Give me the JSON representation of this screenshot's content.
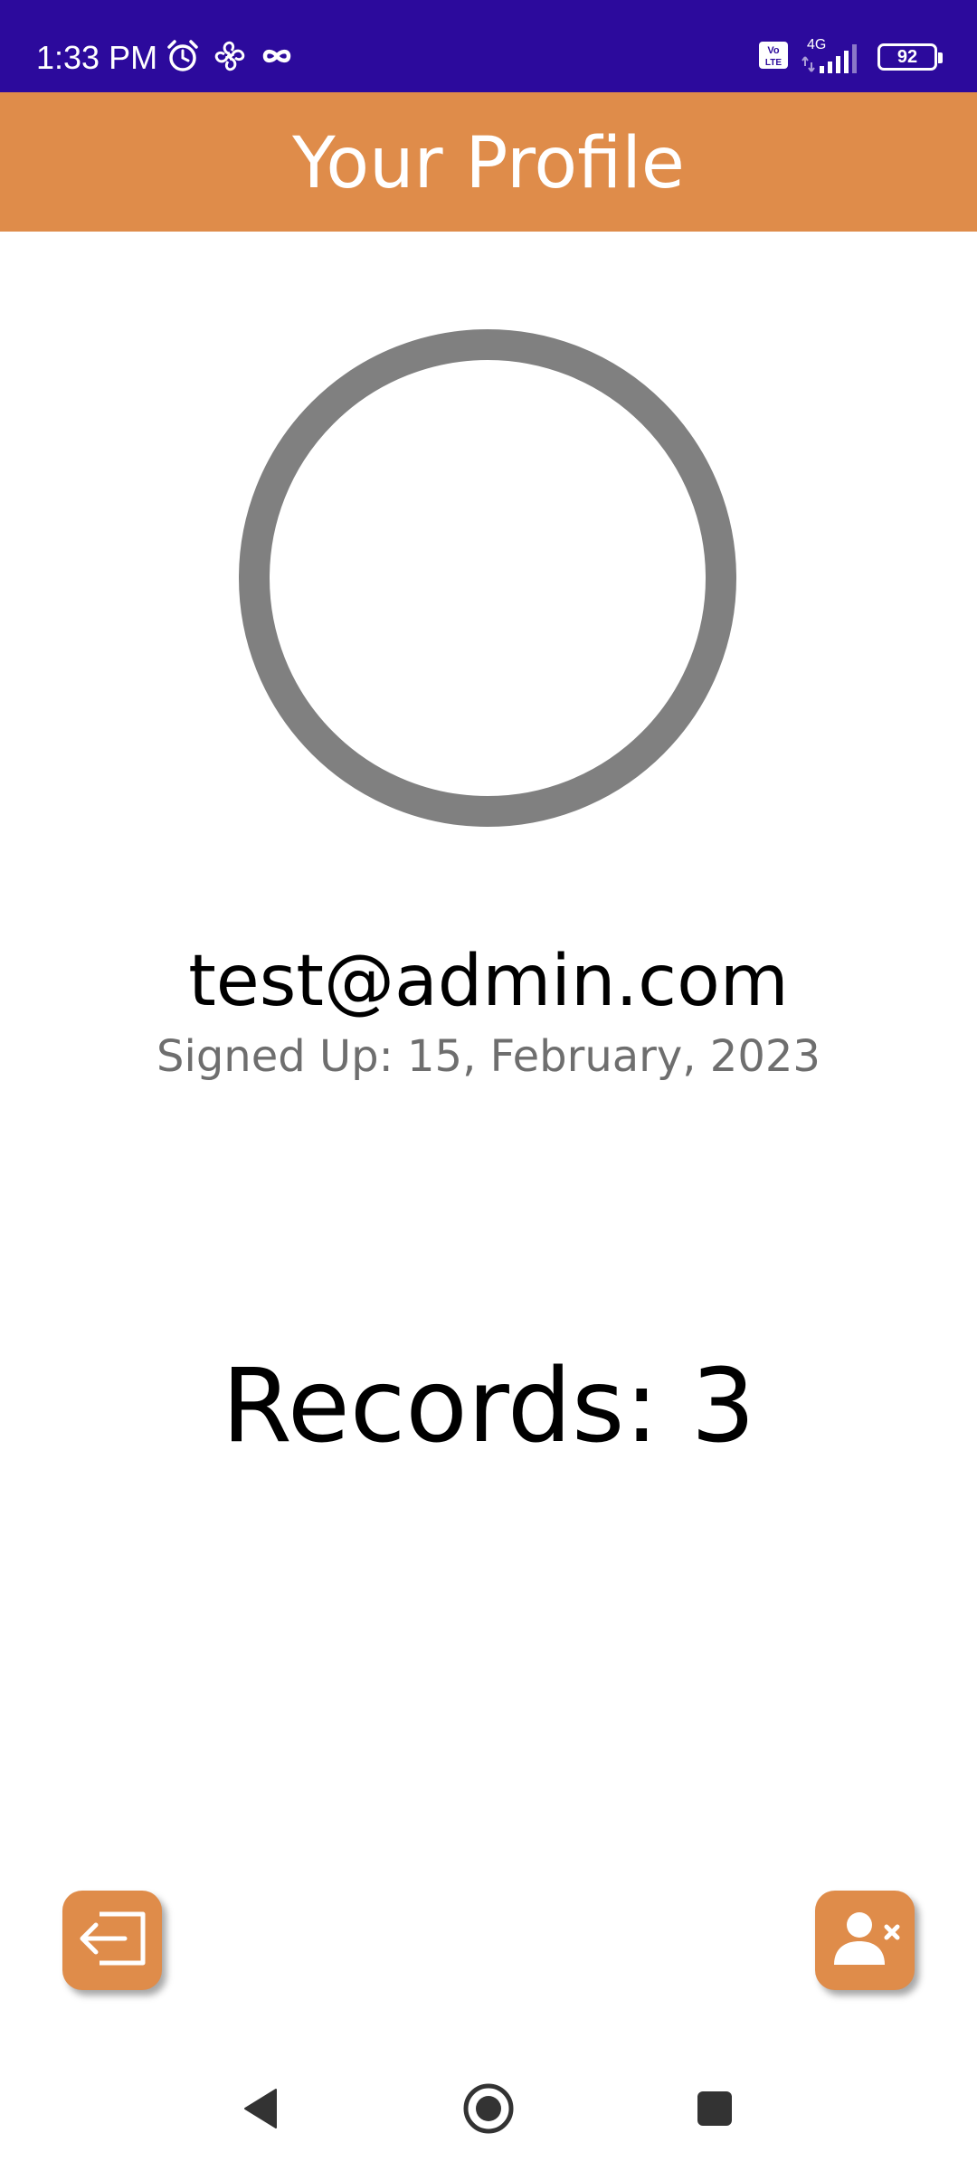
{
  "status_bar": {
    "time": "1:33 PM",
    "left_icons": [
      "alarm-icon",
      "fan-icon",
      "infinity-icon"
    ],
    "right_icons": [
      "volte-icon",
      "4g-signal-icon"
    ],
    "network": "4G",
    "volte": "Vo LTE",
    "battery": "92"
  },
  "header": {
    "title": "Your Profile"
  },
  "profile": {
    "email": "test@admin.com",
    "signed_up": "Signed Up: 15, February, 2023",
    "records": "Records: 3"
  },
  "actions": {
    "logout_icon": "logout-icon",
    "delete_account_icon": "remove-user-icon"
  },
  "colors": {
    "status_bar": "#2c0a9c",
    "accent": "#df8c4a",
    "avatar_ring": "#808080",
    "secondary_text": "#6e6e6e"
  },
  "nav": {
    "icons": [
      "back-icon",
      "home-icon",
      "recents-icon"
    ]
  }
}
